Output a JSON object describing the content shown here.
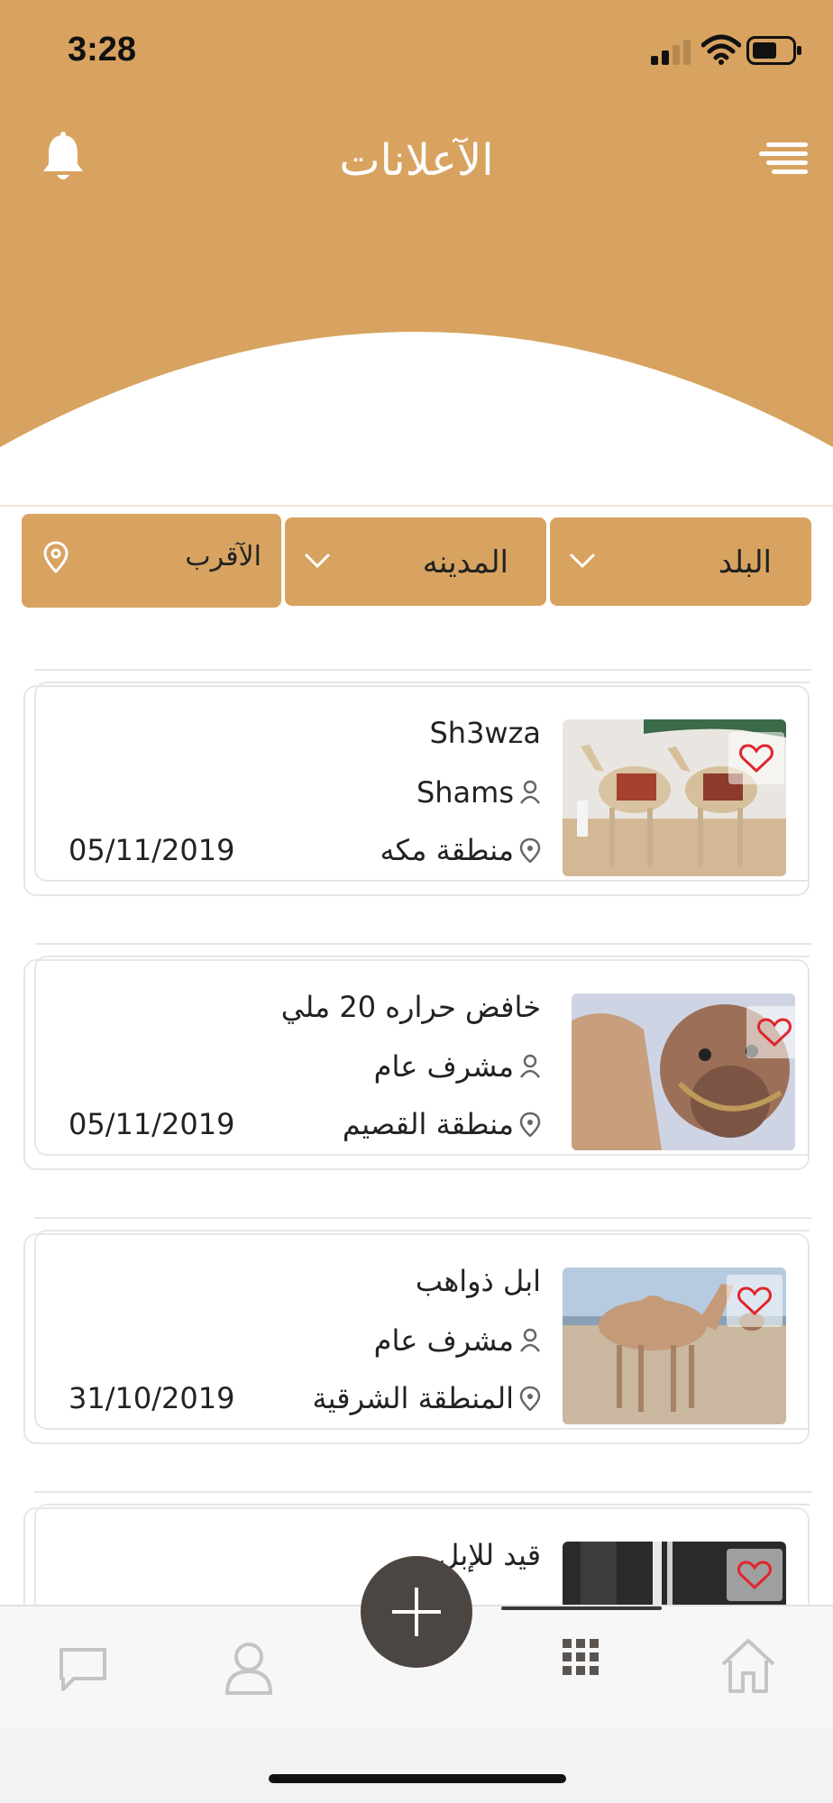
{
  "status_bar": {
    "time": "3:28"
  },
  "header": {
    "title": "الآعلانات"
  },
  "filters": {
    "country": "البلد",
    "city": "المدينه",
    "nearest": "الآقرب"
  },
  "listings": [
    {
      "title": "Sh3wza",
      "user": "Shams",
      "location": "منطقة مكه",
      "date": "05/11/2019"
    },
    {
      "title": "خافض حراره 20 ملي",
      "user": "مشرف عام",
      "location": "منطقة القصيم",
      "date": "05/11/2019"
    },
    {
      "title": "ابل ذواهب",
      "user": "مشرف عام",
      "location": "المنطقة الشرقية",
      "date": "31/10/2019"
    },
    {
      "title": "قيد للإبل"
    }
  ],
  "colors": {
    "accent": "#d8a360",
    "fab": "#4c4642",
    "favorite": "#e0262b"
  },
  "icons": [
    "bell-icon",
    "menu-icon",
    "chevron-down-icon",
    "location-pin-icon",
    "user-icon",
    "heart-icon",
    "chat-icon",
    "profile-icon",
    "plus-icon",
    "grid-icon",
    "home-icon"
  ]
}
